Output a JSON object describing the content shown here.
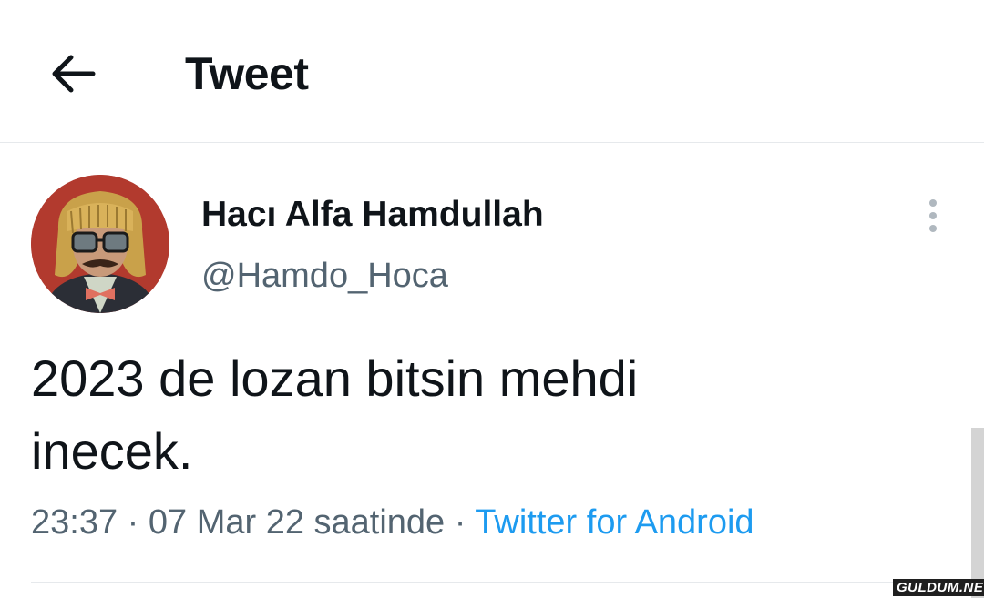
{
  "header": {
    "title": "Tweet",
    "back_icon": "arrow-left-icon"
  },
  "tweet": {
    "author": {
      "name": "Hacı Alfa Hamdullah",
      "handle": "@Hamdo_Hoca",
      "avatar_icon": "avatar"
    },
    "text_line1": "2023 de lozan bitsin mehdi",
    "text_line2": "inecek.",
    "time": "23:37",
    "separator": "·",
    "date": "07 Mar 22 saatinde",
    "source": "Twitter for Android",
    "more_icon": "more-vertical-icon"
  },
  "watermark": "GULDUM.NET",
  "colors": {
    "text": "#0f1419",
    "secondary": "#536471",
    "link": "#1d9bf0",
    "divider": "#e6e9ec"
  }
}
